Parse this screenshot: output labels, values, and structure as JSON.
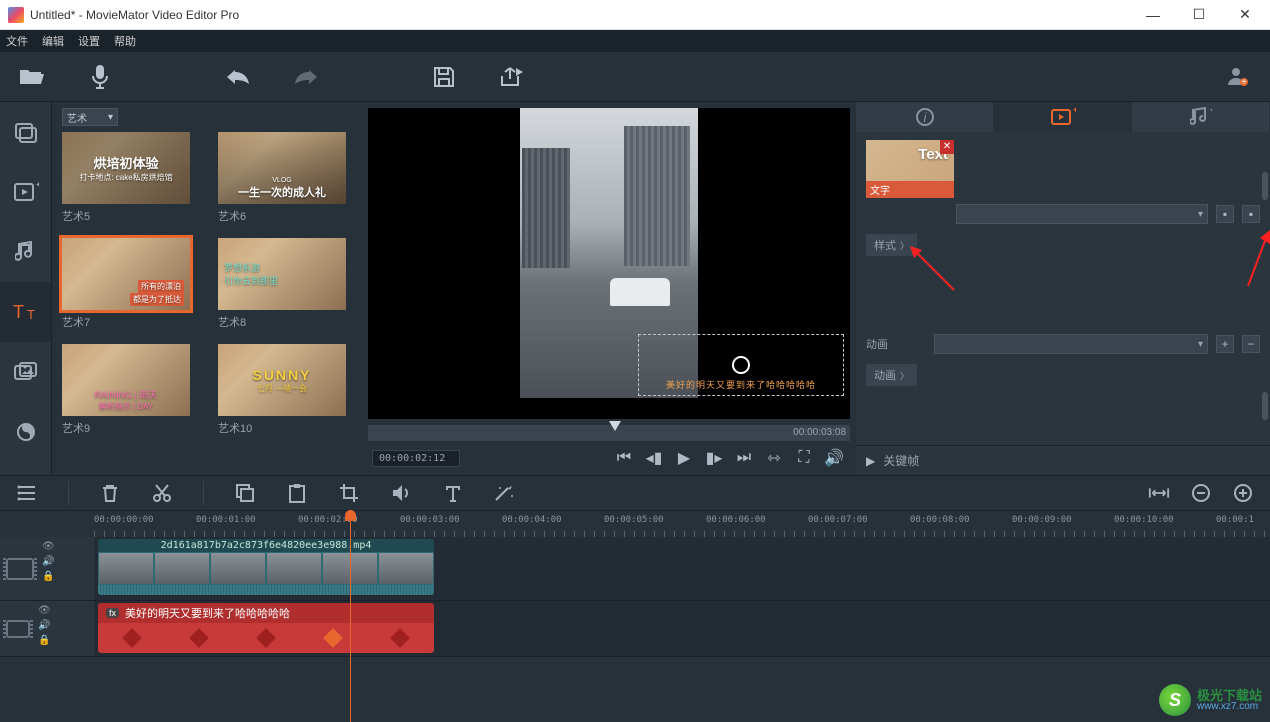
{
  "titlebar": {
    "title": "Untitled* - MovieMator Video Editor Pro"
  },
  "menubar": {
    "items": [
      "文件",
      "编辑",
      "设置",
      "帮助"
    ]
  },
  "library": {
    "category": "艺术",
    "items": [
      {
        "label": "艺术5",
        "overlay1": "烘培初体验",
        "overlay2": "打卡地点: cake私房烘焙馆"
      },
      {
        "label": "艺术6",
        "overlay1": "VLOG",
        "overlay2": "一生一次的成人礼"
      },
      {
        "label": "艺术7",
        "overlay1": "所有的漂泊",
        "overlay2": "都是为了抵达",
        "selected": true
      },
      {
        "label": "艺术8",
        "overlay1": "罗想系游",
        "overlay2": "引你去到那里"
      },
      {
        "label": "艺术9",
        "overlay1": "RAINING",
        "overlay2": "解析指示 | DAY"
      },
      {
        "label": "艺术10",
        "overlay1": "SUNNY",
        "overlay2": "七月 —晴一会"
      }
    ]
  },
  "preview": {
    "overlay_text": "美好的明天又要到来了哈哈哈哈哈",
    "scrub_time": "00:00:03:08",
    "current_time": "00:00:02:12"
  },
  "props": {
    "chip_label": "文字",
    "chip_text": "Text",
    "section_style": "样式",
    "row_anim": "动画",
    "section_anim": "动画",
    "keyframe": "关键帧"
  },
  "ruler": {
    "ticks": [
      "00:00:00:00",
      "00:00:01:00",
      "00:00:02:00",
      "00:00:03:00",
      "00:00:04:00",
      "00:00:05:00",
      "00:00:06:00",
      "00:00:07:00",
      "00:00:08:00",
      "00:00:09:00",
      "00:00:10:00",
      "00:00:1"
    ]
  },
  "timeline": {
    "video_clip_name": "2d161a817b7a2c873f6e4820ee3e988.mp4",
    "text_clip_text": "美好的明天又要到来了哈哈哈哈哈",
    "fx_label": "fx"
  },
  "watermark": {
    "cn": "极光下载站",
    "url": "www.xz7.com",
    "glyph": "S"
  }
}
